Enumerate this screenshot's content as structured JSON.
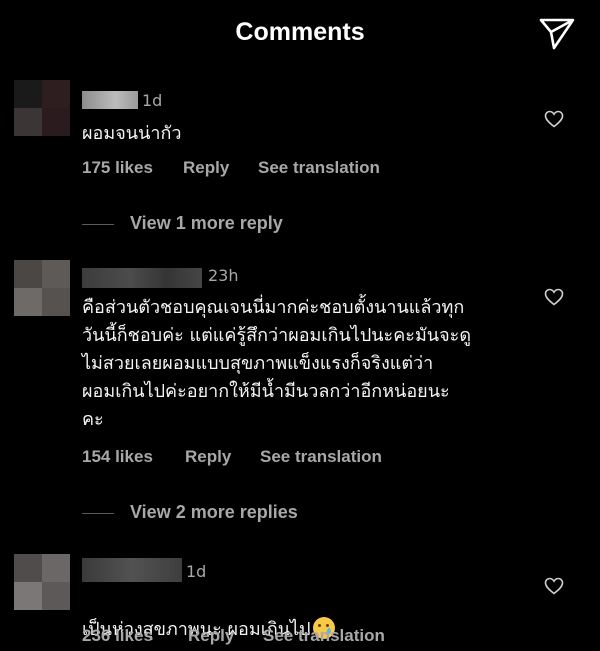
{
  "header": {
    "title": "Comments",
    "send_icon": "paper-plane-icon"
  },
  "comments": [
    {
      "time": "1d",
      "text": "ผอมจนน่ากัว",
      "likes": "175 likes",
      "reply": "Reply",
      "translate": "See translation",
      "more_replies": "View 1 more reply"
    },
    {
      "time": "23h",
      "text": "คือส่วนตัวชอบคุณเจนนี่มากค่ะชอบตั้งนานแล้วทุก\nวันนี้ก็ชอบค่ะ แต่แค่รู้สึกว่าผอมเกินไปนะคะมันจะดู\nไม่สวยเลยผอมแบบสุขภาพแข็งแรงก็จริงแต่ว่า\nผอมเกินไปค่ะอยากให้มีน้ำมีนวลกว่าอีกหน่อยนะ\nคะ",
      "likes": "154 likes",
      "reply": "Reply",
      "translate": "See translation",
      "more_replies": "View 2 more replies"
    },
    {
      "time": "1d",
      "text": "เป็นห่วงสุขภาพนะ ผอมเกินไป",
      "emoji": "crying-face-emoji",
      "likes": "236 likes",
      "reply": "Reply",
      "translate": "See translation"
    }
  ],
  "colors": {
    "background": "#000000",
    "primary_text": "#f5f5f5",
    "secondary_text": "#a8a8a8"
  }
}
